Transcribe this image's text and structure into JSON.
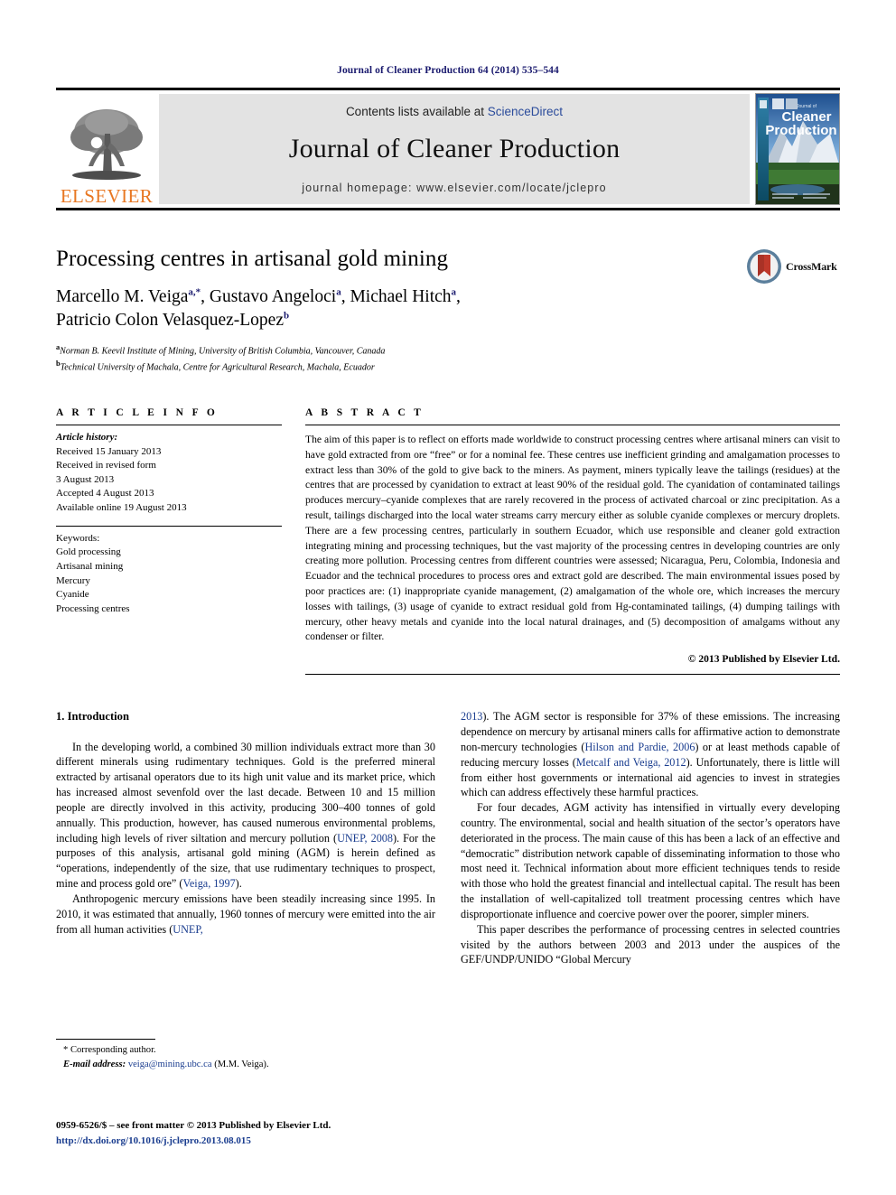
{
  "running_head": "Journal of Cleaner Production 64 (2014) 535–544",
  "masthead": {
    "publisher_name": "ELSEVIER",
    "contents_text": "Contents lists available at ",
    "sciencedirect": "ScienceDirect",
    "journal_title": "Journal of Cleaner Production",
    "homepage": "journal homepage: www.elsevier.com/locate/jclepro",
    "cover": {
      "kicker": "Journal of",
      "line1": "Cleaner",
      "line2": "Production"
    }
  },
  "article": {
    "title": "Processing centres in artisanal gold mining",
    "authors_line1": "Marcello M. Veiga",
    "authors_sup1": "a,*",
    "authors_line1b": ", Gustavo Angeloci",
    "authors_sup2": "a",
    "authors_line1c": ", Michael Hitch",
    "authors_sup3": "a",
    "authors_line1d": ",",
    "authors_line2": "Patricio Colon Velasquez-Lopez",
    "authors_sup4": "b",
    "affiliation_a_sup": "a",
    "affiliation_a": "Norman B. Keevil Institute of Mining, University of British Columbia, Vancouver, Canada",
    "affiliation_b_sup": "b",
    "affiliation_b": "Technical University of Machala, Centre for Agricultural Research, Machala, Ecuador",
    "crossmark_label": "CrossMark"
  },
  "article_info": {
    "heading": "A R T I C L E  I N F O",
    "history_label": "Article history:",
    "history": [
      "Received 15 January 2013",
      "Received in revised form",
      "3 August 2013",
      "Accepted 4 August 2013",
      "Available online 19 August 2013"
    ],
    "keywords_label": "Keywords:",
    "keywords": [
      "Gold processing",
      "Artisanal mining",
      "Mercury",
      "Cyanide",
      "Processing centres"
    ]
  },
  "abstract": {
    "heading": "A B S T R A C T",
    "text": "The aim of this paper is to reflect on efforts made worldwide to construct processing centres where artisanal miners can visit to have gold extracted from ore “free” or for a nominal fee. These centres use inefficient grinding and amalgamation processes to extract less than 30% of the gold to give back to the miners. As payment, miners typically leave the tailings (residues) at the centres that are processed by cyanidation to extract at least 90% of the residual gold. The cyanidation of contaminated tailings produces mercury–cyanide complexes that are rarely recovered in the process of activated charcoal or zinc precipitation. As a result, tailings discharged into the local water streams carry mercury either as soluble cyanide complexes or mercury droplets. There are a few processing centres, particularly in southern Ecuador, which use responsible and cleaner gold extraction integrating mining and processing techniques, but the vast majority of the processing centres in developing countries are only creating more pollution. Processing centres from different countries were assessed; Nicaragua, Peru, Colombia, Indonesia and Ecuador and the technical procedures to process ores and extract gold are described. The main environmental issues posed by poor practices are: (1) inappropriate cyanide management, (2) amalgamation of the whole ore, which increases the mercury losses with tailings, (3) usage of cyanide to extract residual gold from Hg-contaminated tailings, (4) dumping tailings with mercury, other heavy metals and cyanide into the local natural drainages, and (5) decomposition of amalgams without any condenser or filter.",
    "copyright": "© 2013 Published by Elsevier Ltd."
  },
  "introduction": {
    "heading": "1. Introduction",
    "left": {
      "p1_a": "In the developing world, a combined 30 million individuals extract more than 30 different minerals using rudimentary techniques. Gold is the preferred mineral extracted by artisanal operators due to its high unit value and its market price, which has increased almost sevenfold over the last decade. Between 10 and 15 million people are directly involved in this activity, producing 300–400 tonnes of gold annually. This production, however, has caused numerous environmental problems, including high levels of river siltation and mercury pollution (",
      "p1_ref1": "UNEP, 2008",
      "p1_b": "). For the purposes of this analysis, artisanal gold mining (AGM) is herein defined as “operations, independently of the size, that use rudimentary techniques to prospect, mine and process gold ore” (",
      "p1_ref2": "Veiga, 1997",
      "p1_c": ").",
      "p2_a": "Anthropogenic mercury emissions have been steadily increasing since 1995. In 2010, it was estimated that annually, 1960 tonnes of mercury were emitted into the air from all human activities (",
      "p2_ref": "UNEP,"
    },
    "right": {
      "p2_cont_ref": "2013",
      "p2_cont_a": "). The AGM sector is responsible for 37% of these emissions. The increasing dependence on mercury by artisanal miners calls for affirmative action to demonstrate non-mercury technologies (",
      "p2_ref2": "Hilson and Pardie, 2006",
      "p2_cont_b": ") or at least methods capable of reducing mercury losses (",
      "p2_ref3": "Metcalf and Veiga, 2012",
      "p2_cont_c": "). Unfortunately, there is little will from either host governments or international aid agencies to invest in strategies which can address effectively these harmful practices.",
      "p3": "For four decades, AGM activity has intensified in virtually every developing country. The environmental, social and health situation of the sector’s operators have deteriorated in the process. The main cause of this has been a lack of an effective and “democratic” distribution network capable of disseminating information to those who most need it. Technical information about more efficient techniques tends to reside with those who hold the greatest financial and intellectual capital. The result has been the installation of well-capitalized toll treatment processing centres which have disproportionate influence and coercive power over the poorer, simpler miners.",
      "p4": "This paper describes the performance of processing centres in selected countries visited by the authors between 2003 and 2013 under the auspices of the GEF/UNDP/UNIDO “Global Mercury"
    }
  },
  "footnote": {
    "corresponding": "* Corresponding author.",
    "email_label": "E-mail address:",
    "email": "veiga@mining.ubc.ca",
    "email_owner": "(M.M. Veiga)."
  },
  "footer": {
    "issn_line": "0959-6526/$ – see front matter © 2013 Published by Elsevier Ltd.",
    "doi": "http://dx.doi.org/10.1016/j.jclepro.2013.08.015"
  },
  "colors": {
    "link_blue": "#1a3d8f",
    "header_blue": "#1a1a6e",
    "elsevier_orange": "#e87722",
    "banner_gray": "#e3e3e3"
  }
}
